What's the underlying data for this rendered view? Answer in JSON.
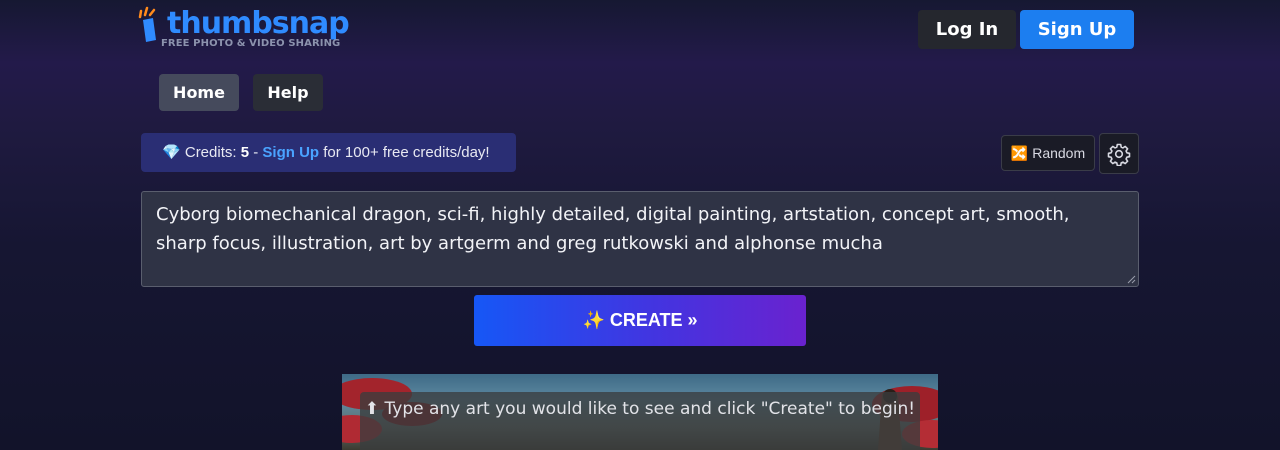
{
  "header": {
    "logo": {
      "name": "thumbsnap",
      "tagline": "FREE PHOTO & VIDEO SHARING"
    },
    "login_label": "Log In",
    "signup_label": "Sign Up"
  },
  "nav": {
    "items": [
      {
        "label": "Home",
        "active": true
      },
      {
        "label": "Help",
        "active": false
      }
    ]
  },
  "credits": {
    "icon": "gem-icon",
    "prefix": "Credits:",
    "count": "5",
    "separator": "-",
    "link_label": "Sign Up",
    "suffix": "for 100+ free credits/day!"
  },
  "toolbar": {
    "random_icon": "shuffle-icon",
    "random_label": "Random",
    "settings_icon": "gear-icon"
  },
  "prompt": {
    "value": "Cyborg biomechanical dragon, sci-fi, highly detailed, digital painting, artstation, concept art, smooth, sharp focus, illustration, art by artgerm and greg rutkowski and alphonse mucha"
  },
  "create": {
    "icon": "sparkles-icon",
    "label": "CREATE »"
  },
  "preview": {
    "hint": "⬆ Type any art you would like to see and click \"Create\" to begin!"
  },
  "colors": {
    "brand_blue": "#1c7ef0",
    "link_blue": "#4aa3ff",
    "credits_bg": "#2a2e74",
    "create_start": "#1657f6",
    "create_end": "#6a22cf"
  }
}
